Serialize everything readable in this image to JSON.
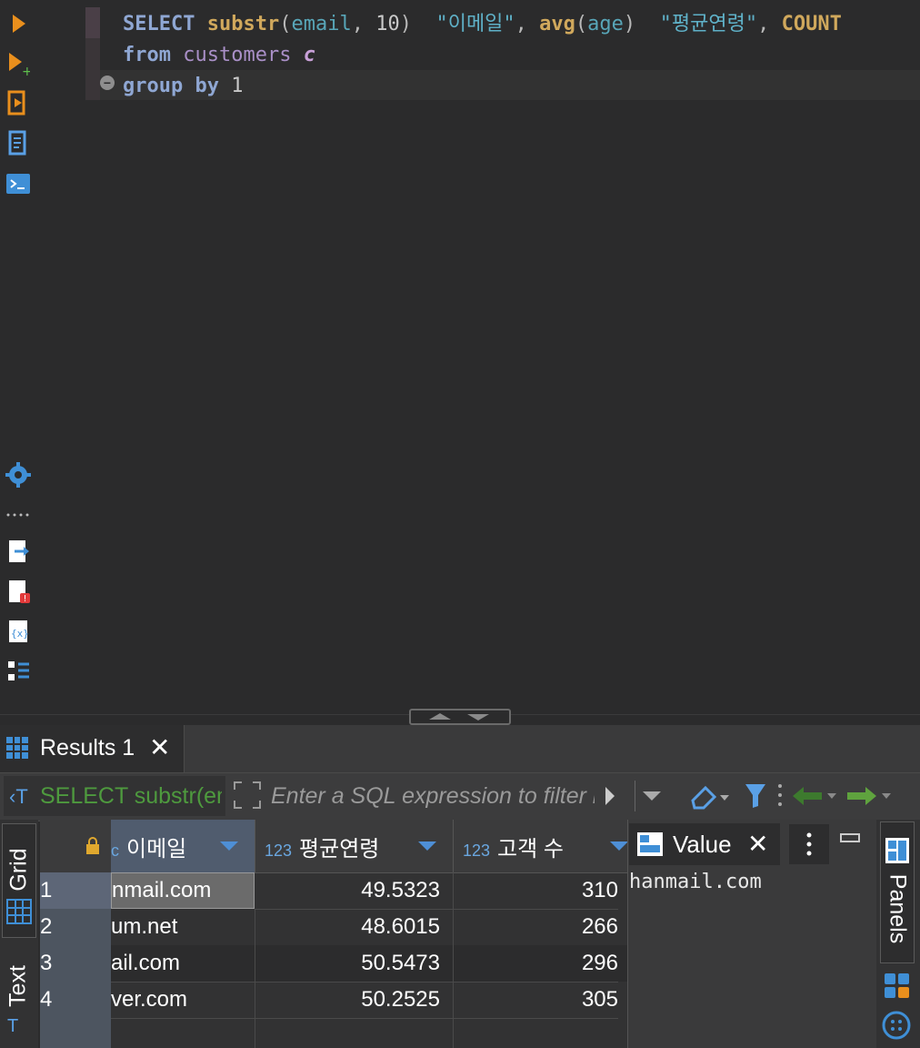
{
  "editor": {
    "line1": {
      "select": "SELECT",
      "fn1": "substr",
      "open1": "(",
      "arg1": "email",
      "sep1": ", ",
      "arg2": "10",
      "close1": ")",
      "alias1": "\"이메일\"",
      "comma1": ", ",
      "fn2": "avg",
      "open2": "(",
      "arg3": "age",
      "close2": ")",
      "alias2": "\"평균연령\"",
      "comma2": ", ",
      "fn3": "COUNT"
    },
    "line2": {
      "from": "from",
      "table": "customers",
      "alias": "c"
    },
    "line3": {
      "group": "group",
      "by": "by",
      "num": "1"
    }
  },
  "results": {
    "tab_label": "Results 1",
    "filter_sql": "SELECT substr(email",
    "filter_placeholder": "Enter a SQL expression to filter results"
  },
  "grid": {
    "columns": [
      {
        "type": "",
        "name": "이메일"
      },
      {
        "type": "123",
        "name": "평균연령"
      },
      {
        "type": "123",
        "name": "고객 수"
      }
    ],
    "rows": [
      {
        "num": "1",
        "email": "nmail.com",
        "avg": "49.5323",
        "count": "310"
      },
      {
        "num": "2",
        "email": "um.net",
        "avg": "48.6015",
        "count": "266"
      },
      {
        "num": "3",
        "email": "ail.com",
        "avg": "50.5473",
        "count": "296"
      },
      {
        "num": "4",
        "email": "ver.com",
        "avg": "50.2525",
        "count": "305"
      }
    ]
  },
  "side_tabs": {
    "grid": "Grid",
    "text": "Text",
    "panels": "Panels"
  },
  "value_panel": {
    "tab_label": "Value",
    "content": "hanmail.com"
  },
  "colors": {
    "accent": "#4e8fd6",
    "sql_filter_green": "#4e9a3e",
    "toolbar_orange": "#e98f1d"
  }
}
